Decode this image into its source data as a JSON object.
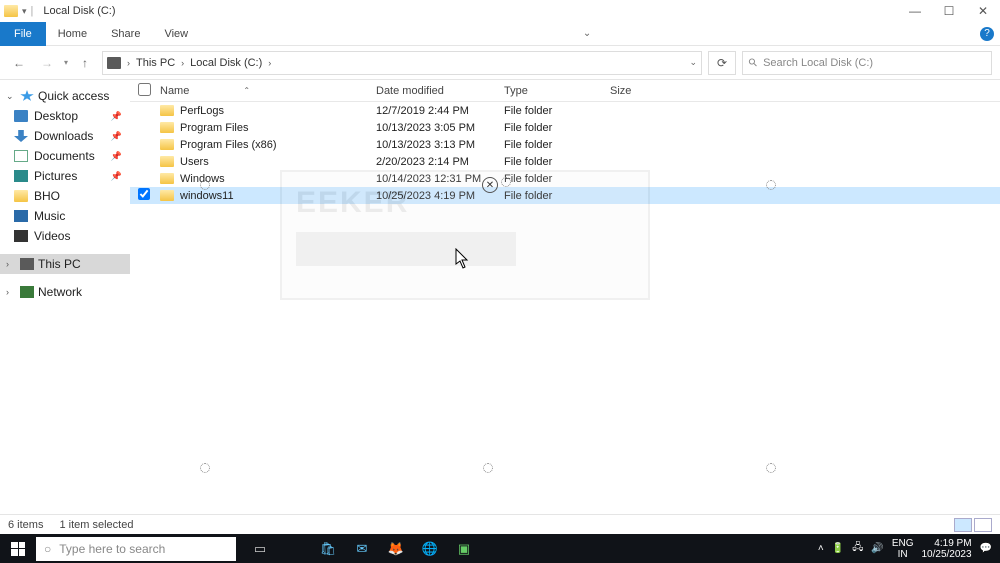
{
  "window": {
    "title": "Local Disk (C:)",
    "controls": {
      "min": "—",
      "max": "☐",
      "close": "✕"
    }
  },
  "ribbon": {
    "file": "File",
    "tabs": [
      "Home",
      "Share",
      "View"
    ]
  },
  "address": {
    "back": "←",
    "forward": "→",
    "up": "↑",
    "crumbs": [
      "This PC",
      "Local Disk (C:)"
    ],
    "refresh": "⟳",
    "search_placeholder": "Search Local Disk (C:)"
  },
  "sidebar": {
    "quick": {
      "label": "Quick access",
      "items": [
        {
          "icon": "ic-desktop",
          "label": "Desktop",
          "pinned": true
        },
        {
          "icon": "ic-downloads",
          "label": "Downloads",
          "pinned": true
        },
        {
          "icon": "ic-doc",
          "label": "Documents",
          "pinned": true
        },
        {
          "icon": "ic-pic",
          "label": "Pictures",
          "pinned": true
        },
        {
          "icon": "ic-folder",
          "label": "BHO",
          "pinned": false
        },
        {
          "icon": "ic-music",
          "label": "Music",
          "pinned": false
        },
        {
          "icon": "ic-video",
          "label": "Videos",
          "pinned": false
        }
      ]
    },
    "thispc": "This PC",
    "network": "Network"
  },
  "columns": {
    "name": "Name",
    "date": "Date modified",
    "type": "Type",
    "size": "Size"
  },
  "files": [
    {
      "name": "PerfLogs",
      "date": "12/7/2019 2:44 PM",
      "type": "File folder",
      "selected": false
    },
    {
      "name": "Program Files",
      "date": "10/13/2023 3:05 PM",
      "type": "File folder",
      "selected": false
    },
    {
      "name": "Program Files (x86)",
      "date": "10/13/2023 3:13 PM",
      "type": "File folder",
      "selected": false
    },
    {
      "name": "Users",
      "date": "2/20/2023 2:14 PM",
      "type": "File folder",
      "selected": false
    },
    {
      "name": "Windows",
      "date": "10/14/2023 12:31 PM",
      "type": "File folder",
      "selected": false
    },
    {
      "name": "windows11",
      "date": "10/25/2023 4:19 PM",
      "type": "File folder",
      "selected": true
    }
  ],
  "status": {
    "items": "6 items",
    "selected": "1 item selected"
  },
  "taskbar": {
    "search_placeholder": "Type here to search",
    "lang_top": "ENG",
    "lang_bot": "IN",
    "time": "4:19 PM",
    "date": "10/25/2023"
  },
  "watermark": "EEKER"
}
